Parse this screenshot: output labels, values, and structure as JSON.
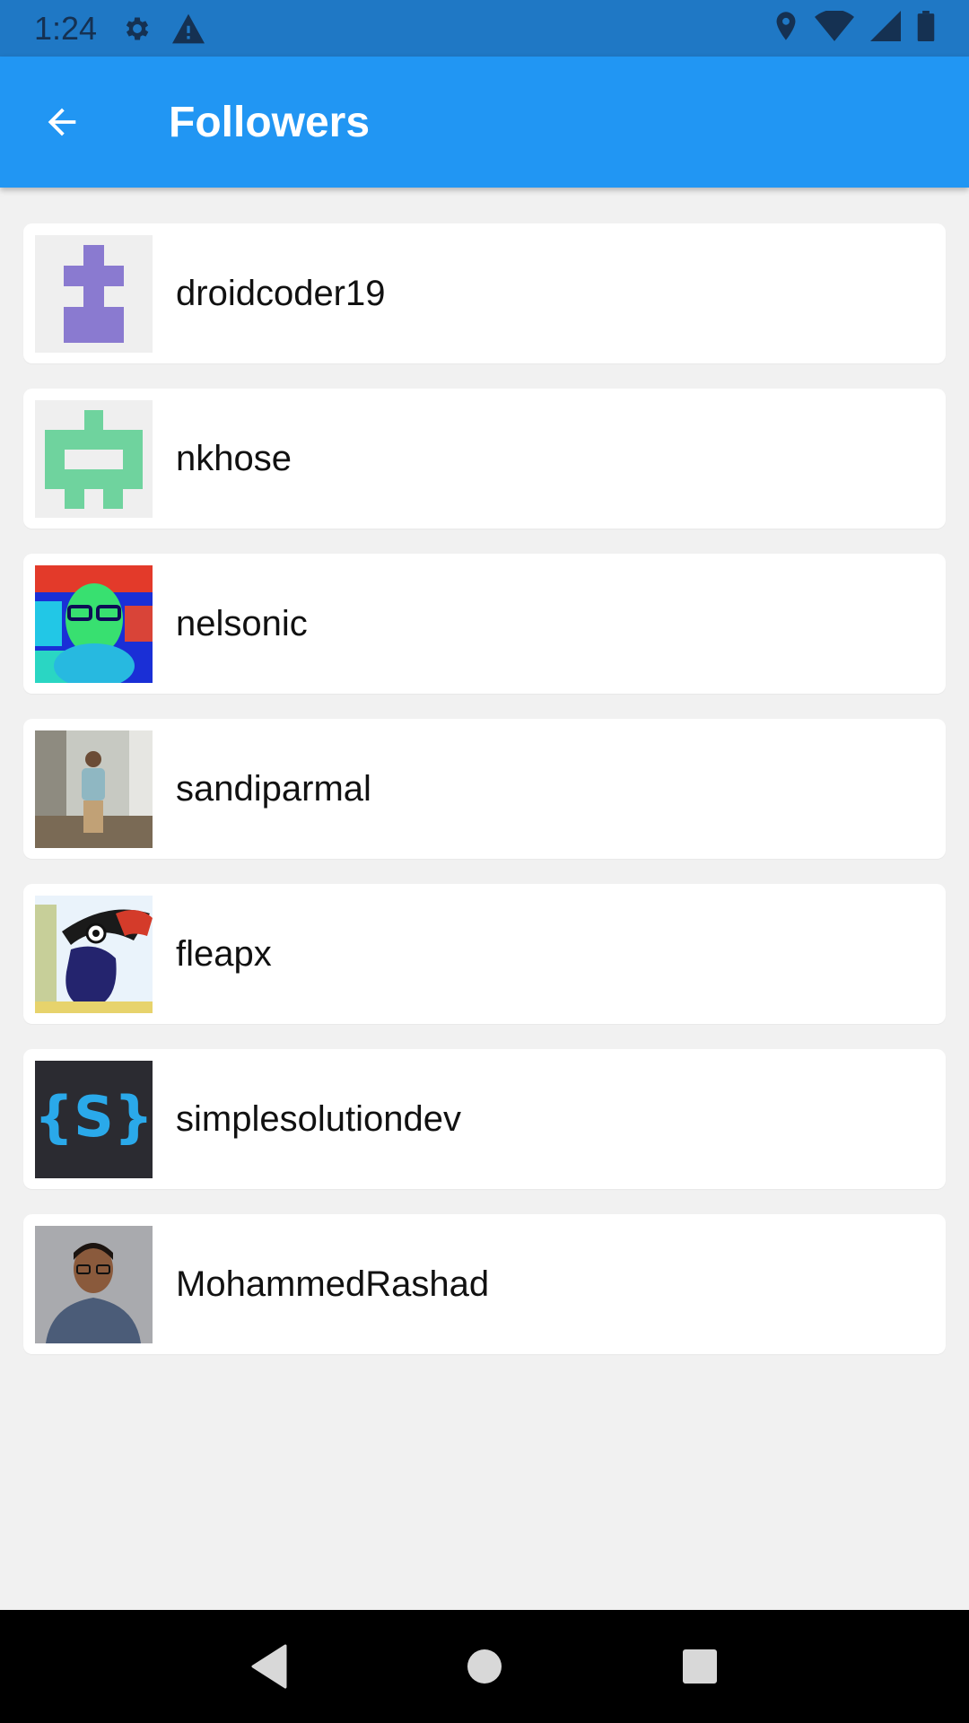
{
  "status_bar": {
    "time": "1:24",
    "icons_left": [
      "settings-icon",
      "warning-icon"
    ],
    "icons_right": [
      "location-icon",
      "wifi-icon",
      "signal-icon",
      "battery-icon"
    ]
  },
  "app_bar": {
    "title": "Followers",
    "back_icon": "arrow-back-icon",
    "color": "#2196f3"
  },
  "followers": [
    {
      "username": "droidcoder19",
      "avatar": "identicon-purple"
    },
    {
      "username": "nkhose",
      "avatar": "identicon-green"
    },
    {
      "username": "nelsonic",
      "avatar": "photo-thermal-portrait"
    },
    {
      "username": "sandiparmal",
      "avatar": "photo-man-standing"
    },
    {
      "username": "fleapx",
      "avatar": "cartoon-woodpecker"
    },
    {
      "username": "simplesolutiondev",
      "avatar": "logo-curly-s"
    },
    {
      "username": "MohammedRashad",
      "avatar": "photo-man-glasses"
    }
  ],
  "nav_bar": {
    "buttons": [
      "back-nav-icon",
      "home-nav-icon",
      "recents-nav-icon"
    ]
  }
}
